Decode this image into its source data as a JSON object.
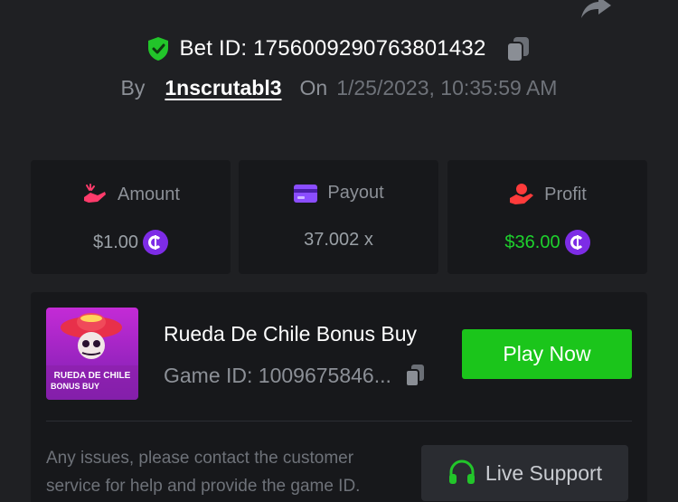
{
  "bet": {
    "label": "Bet ID: 1756009290763801432",
    "by_label": "By",
    "username": "1nscrutabl3",
    "on_label": "On",
    "date": "1/25/2023, 10:35:59 AM"
  },
  "stats": [
    {
      "label": "Amount",
      "value": "$1.00",
      "icon": "money-hand-icon"
    },
    {
      "label": "Payout",
      "value": "37.002 x",
      "icon": "card-icon"
    },
    {
      "label": "Profit",
      "value": "$36.00",
      "icon": "profit-hand-icon"
    }
  ],
  "game": {
    "title": "Rueda De Chile Bonus Buy",
    "id_label": "Game ID: 1009675846...",
    "thumb_line1": "RUEDA DE CHILE",
    "thumb_line2": "BONUS BUY",
    "play_label": "Play Now"
  },
  "support": {
    "help_text": "Any issues, please contact the customer service for help and provide the game ID.",
    "live_label": "Live Support"
  },
  "colors": {
    "background": "#1f2023",
    "card": "#17181b",
    "accent_green": "#1bc51b",
    "profit_green": "#1ed12d",
    "coin_purple": "#7d2ce6",
    "amount_icon_pink": "#ff3b6b",
    "payout_icon_purple": "#8b4dff",
    "profit_icon_red": "#ff3b3b"
  }
}
